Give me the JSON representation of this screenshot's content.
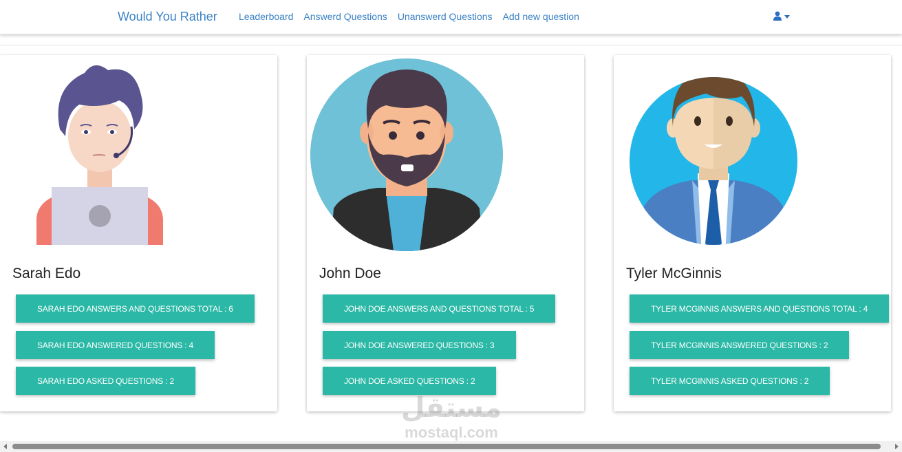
{
  "navbar": {
    "brand": "Would You Rather",
    "links": [
      "Leaderboard",
      "Answerd Questions",
      "Unanswerd Questions",
      "Add new question"
    ],
    "user_icon": "user-icon"
  },
  "colors": {
    "accent": "#2bb8a6",
    "link": "#3b82c4"
  },
  "users": [
    {
      "name": "Sarah Edo",
      "total_label": "SARAH EDO ANSWERS AND QUESTIONS TOTAL : 6",
      "answered_label": "SARAH EDO ANSWERED QUESTIONS : 4",
      "asked_label": "SARAH EDO ASKED QUESTIONS : 2"
    },
    {
      "name": "John Doe",
      "total_label": "JOHN DOE ANSWERS AND QUESTIONS TOTAL : 5",
      "answered_label": "JOHN DOE ANSWERED QUESTIONS : 3",
      "asked_label": "JOHN DOE ASKED QUESTIONS : 2"
    },
    {
      "name": "Tyler McGinnis",
      "total_label": "TYLER MCGINNIS ANSWERS AND QUESTIONS TOTAL : 4",
      "answered_label": "TYLER MCGINNIS ANSWERED QUESTIONS : 2",
      "asked_label": "TYLER MCGINNIS ASKED QUESTIONS : 2"
    }
  ],
  "watermark": {
    "arabic": "مستقل",
    "latin": "mostaql.com"
  }
}
